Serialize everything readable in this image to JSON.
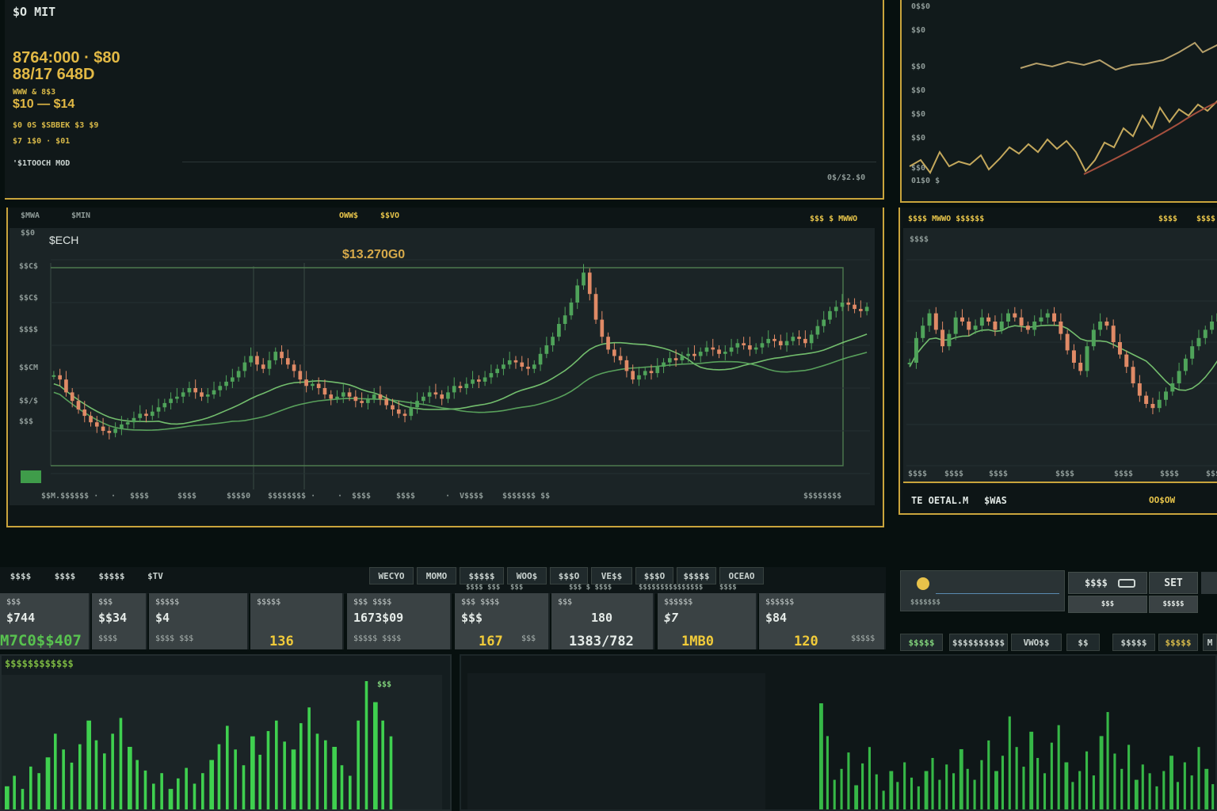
{
  "top_left": {
    "title": "$O MIT",
    "stat_line_1": "8764:000 · $80",
    "stat_line_2": "88/17 648D",
    "stat_small_1": "WWW & 8$3",
    "stat_line_3": "$10 — $14",
    "stat_small_2": "$0 0S $SBBEK $3 $9",
    "stat_small_3": "$7 1$0 · $01",
    "stat_small_4": "'$1TOOCH MOD",
    "footer_right": "0$/$2.$0"
  },
  "top_right": {
    "axis_labels": [
      "0$$0",
      "$$0",
      "$$0",
      "$$0",
      "$$0",
      "$$0",
      "$$0"
    ],
    "footer_left": "01$0 $"
  },
  "main_chart": {
    "header_left": [
      "$MWA",
      "$MIN"
    ],
    "header_mid": [
      "OWW$",
      "$$VO"
    ],
    "header_right": "$$$ $ MWWO",
    "panel_title": "$ECH",
    "price_label": "$13.270G0",
    "y_labels": [
      "$$0",
      "$$C$",
      "$$C$",
      "$$$$",
      "$$CM",
      "$$/$",
      "$$$"
    ],
    "volume_badge": "$$",
    "x_labels": [
      "$$M.$$$$$$ ·",
      "·",
      "$$$$",
      "$$$$",
      "$$$$0",
      "$$$$$$$$ ·",
      "·",
      "$$$$",
      "$$$$",
      "·",
      "V$$$$",
      "$$$$$$$ $$",
      "$$$$$$$$"
    ],
    "chart_data": {
      "type": "candlestick",
      "title": "",
      "xlabel": "",
      "ylabel": "",
      "price_label": "$13.270G0",
      "ylim": [
        0,
        100
      ],
      "close": [
        46,
        44,
        38,
        34,
        30,
        27,
        24,
        22,
        20,
        19,
        21,
        23,
        24,
        26,
        28,
        27,
        29,
        31,
        33,
        35,
        36,
        38,
        40,
        38,
        36,
        37,
        39,
        41,
        43,
        45,
        48,
        52,
        55,
        51,
        49,
        53,
        57,
        54,
        51,
        48,
        44,
        41,
        42,
        40,
        37,
        35,
        36,
        38,
        36,
        34,
        33,
        35,
        37,
        35,
        32,
        30,
        28,
        27,
        31,
        34,
        36,
        38,
        37,
        35,
        38,
        41,
        40,
        42,
        44,
        43,
        45,
        47,
        49,
        51,
        53,
        52,
        50,
        49,
        51,
        56,
        60,
        64,
        70,
        74,
        80,
        88,
        94,
        84,
        72,
        64,
        58,
        55,
        53,
        48,
        44,
        46,
        48,
        47,
        50,
        52,
        54,
        53,
        55,
        56,
        55,
        57,
        59,
        58,
        56,
        57,
        59,
        61,
        60,
        58,
        59,
        61,
        63,
        62,
        60,
        62,
        64,
        63,
        61,
        65,
        69,
        72,
        76,
        78,
        80,
        79,
        77,
        76,
        78
      ]
    }
  },
  "right_chart": {
    "header": "$$$$ MWWO $$$$$$",
    "header_right": [
      "$$$$",
      "$$$$"
    ],
    "axis_top": "$$$$",
    "x_labels": [
      "$$$$",
      "$$$$",
      "$$$$",
      "$$$$",
      "$$$$",
      "$$$$",
      "$$$$"
    ],
    "footer_left": "TE OETAL.M",
    "footer_mid": "$WAS",
    "footer_right": "OO$OW",
    "chart_data": {
      "type": "candlestick",
      "title": "",
      "ylim": [
        0,
        100
      ],
      "close": [
        50,
        62,
        68,
        74,
        66,
        58,
        64,
        72,
        70,
        66,
        68,
        72,
        70,
        66,
        70,
        74,
        72,
        68,
        66,
        70,
        72,
        74,
        70,
        64,
        56,
        50,
        46,
        58,
        66,
        70,
        68,
        60,
        54,
        48,
        40,
        34,
        30,
        28,
        32,
        36,
        40,
        46,
        52,
        58,
        62,
        66,
        70,
        74
      ]
    }
  },
  "toolbar": {
    "left_tabs": [
      "$$$$",
      "$$$$",
      "$$$$$",
      "$TV"
    ],
    "mid_tabs": [
      "WECYO",
      "MOMO",
      "$$$$$",
      "WOO$",
      "$$$O",
      "VE$$",
      "$$$O",
      "$$$$$",
      "OCEAO"
    ],
    "sub_labels": [
      "$$$$ $$$",
      "$$$",
      "$$$ $ $$$$",
      "$$$$$$$$$$$$$$$",
      "$$$$"
    ],
    "right_search_placeholder": "$$$$$$$",
    "right_buttons": [
      "$$$$",
      "SET"
    ],
    "right_sub": [
      "$$$",
      "$$$$$"
    ]
  },
  "stats_row": [
    {
      "top": "$$$",
      "mid": "$744",
      "bot": "",
      "big": ""
    },
    {
      "top": "$$$",
      "mid": "$$34",
      "bot": "$$$$",
      "big": ""
    },
    {
      "top": "$$$$$",
      "mid": "$4",
      "bot": "$$$$   $$$",
      "big": ""
    },
    {
      "top": "$$$$$",
      "mid": "",
      "bot": "",
      "big": "136"
    },
    {
      "top": "$$$ $$$$",
      "mid": "1673$09",
      "bot": "$$$$$   $$$$",
      "big": ""
    },
    {
      "top": "$$$ $$$$",
      "mid": "$$$",
      "bot": "",
      "big": "167",
      "big2": "$$$"
    },
    {
      "top": "$$$",
      "mid": "180",
      "bot": "",
      "big": "1383/782"
    },
    {
      "top": "$$$$$$",
      "mid": "$7",
      "bot": "",
      "big": "1MB0"
    },
    {
      "top": "$$$$$$",
      "mid": "$84",
      "bot": "",
      "big": "120",
      "big2": "$$$$$"
    }
  ],
  "stats_left_value": "M7C0$$407",
  "bottom_left": {
    "title": "$$$$$$$$$$$$",
    "badge": "$$$",
    "chart_data": {
      "type": "bar",
      "title": "",
      "ylim": [
        0,
        100
      ],
      "values": [
        20,
        28,
        18,
        35,
        30,
        42,
        60,
        48,
        38,
        52,
        70,
        55,
        45,
        60,
        72,
        50,
        40,
        32,
        22,
        30,
        18,
        26,
        34,
        22,
        30,
        40,
        52,
        66,
        48,
        36,
        58,
        44,
        62,
        70,
        54,
        48,
        68,
        80,
        60,
        55,
        50,
        36,
        28,
        70,
        100,
        84,
        70,
        58
      ]
    }
  },
  "bottom_right_tabs": [
    "$$$$$",
    "$$$$$$$$$$",
    "VWO$$",
    "$$",
    "$$$$$",
    "$$$$$",
    "M"
  ],
  "bottom_right": {
    "chart_data": {
      "type": "bar",
      "title": "",
      "ylim": [
        0,
        100
      ],
      "values": [
        100,
        70,
        30,
        40,
        55,
        25,
        45,
        60,
        35,
        20,
        38,
        28,
        46,
        32,
        24,
        38,
        50,
        30,
        44,
        36,
        58,
        40,
        30,
        48,
        66,
        38,
        52,
        88,
        60,
        42,
        74,
        50,
        36,
        64,
        80,
        46,
        28,
        38,
        56,
        34,
        70,
        92,
        54,
        40,
        62,
        30,
        44,
        36,
        24,
        38,
        52,
        28,
        46,
        34,
        60,
        40,
        26
      ]
    }
  },
  "colors": {
    "background": "#07100f",
    "panel": "#131c1e",
    "border_gold": "#c9a43c",
    "up": "#4fa35a",
    "down": "#e08a66",
    "ma_line": "#7dcf76",
    "bar_green": "#3fd04f",
    "highlight_yellow": "#f1cb3a"
  }
}
